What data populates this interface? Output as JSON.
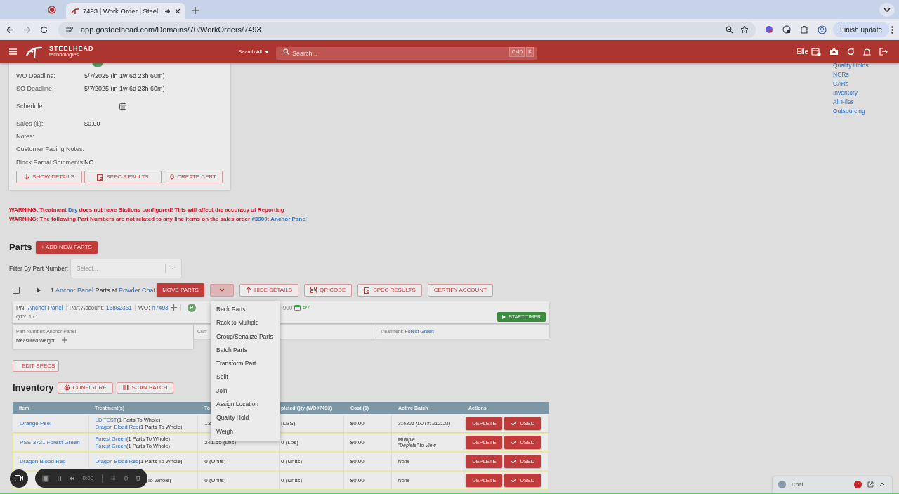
{
  "browser": {
    "tab_title": "7493 | Work Order | Steel",
    "url": "app.gosteelhead.com/Domains/70/WorkOrders/7493",
    "update_button": "Finish update"
  },
  "header": {
    "brand": "STEELHEAD",
    "brand_sub": "technologies",
    "search_scope": "Search All",
    "search_placeholder": "Search...",
    "shortcut_keys": [
      "CMD",
      "K"
    ],
    "user": "Elle"
  },
  "work_order": {
    "fields": [
      {
        "label": "WO Deadline:",
        "kind": "text",
        "value": "5/7/2025 (in 1w 6d 23h 60m)"
      },
      {
        "label": "SO Deadline:",
        "kind": "text",
        "value": "5/7/2025 (in 1w 6d 23h 60m)"
      },
      {
        "label": "Schedule:",
        "kind": "calendar"
      },
      {
        "label": "Sales ($):",
        "kind": "text",
        "value": "$0.00"
      },
      {
        "label": "Notes:",
        "kind": "text"
      },
      {
        "label": "Customer Facing Notes:",
        "kind": "text"
      },
      {
        "label": "Block Partial Shipments:",
        "kind": "text",
        "value": "NO"
      }
    ],
    "buttons": [
      "SHOW DETAILS",
      "SPEC RESULTS",
      "CREATE CERT"
    ]
  },
  "side_links": [
    "Quality Holds",
    "NCRs",
    "CARs",
    "Inventory",
    "All Files",
    "Outsourcing"
  ],
  "warnings": [
    [
      {
        "kind": "text",
        "text": "WARNING: Treatment "
      },
      {
        "kind": "link",
        "text": "Dry"
      },
      {
        "kind": "text",
        "text": " does not have Stations configured! This will affect the accuracy of Reporting"
      }
    ],
    [
      {
        "kind": "text",
        "text": "WARNING: The following Part Numbers are not related to any line items on the sales order "
      },
      {
        "kind": "link",
        "text": "#3900"
      },
      {
        "kind": "text",
        "text": ": "
      },
      {
        "kind": "link",
        "text": "Anchor Panel"
      }
    ]
  ],
  "parts": {
    "title": "Parts",
    "add_button": "+ ADD NEW PARTS",
    "filter_label": "Filter By Part Number:",
    "filter_placeholder": "Select...",
    "group": {
      "checked": false,
      "summary": [
        {
          "kind": "text",
          "text": "1 "
        },
        {
          "kind": "link",
          "text": "Anchor Panel"
        },
        {
          "kind": "text",
          "text": " Parts at "
        },
        {
          "kind": "link",
          "text": "Powder Coat"
        }
      ],
      "buttons": [
        {
          "kind": "primary",
          "label": "MOVE PARTS"
        },
        {
          "kind": "caret",
          "selected": true
        },
        {
          "kind": "outline",
          "label": "HIDE DETAILS"
        },
        {
          "kind": "outline",
          "label": "QR CODE"
        },
        {
          "kind": "outline",
          "label": "SPEC RESULTS"
        },
        {
          "kind": "outline",
          "label": "CERTIFY ACCOUNT"
        }
      ]
    },
    "part": {
      "pn_label": "PN:",
      "pn": "Anchor Panel",
      "account_label": "Part Account:",
      "account": "16862361",
      "wo_label": "WO:",
      "wo": "#7493",
      "avatar": "P",
      "order_tail": "900",
      "date": "5/7",
      "qty": "QTY: 1 / 1",
      "timer_button": "START TIMER",
      "details": [
        {
          "lines": [
            {
              "kind": "text",
              "label": "Part Number: Anchor Panel"
            },
            {
              "kind": "add",
              "label": "Measured Weight:"
            }
          ]
        },
        {
          "lines": [
            {
              "kind": "text",
              "label": "Curr"
            }
          ]
        },
        {
          "lines": [
            {
              "kind": "link",
              "label": "Treatment: ",
              "value": "Forest Green"
            }
          ]
        }
      ]
    },
    "edit_specs": "EDIT SPECS"
  },
  "menu": [
    "Rack Parts",
    "Rack to Multiple",
    "Group/Serialize Parts",
    "Batch Parts",
    "Transform Part",
    "Split",
    "Join",
    "Assign Location",
    "Quality Hold",
    "Weigh"
  ],
  "inventory": {
    "title": "Inventory",
    "buttons": [
      "CONFIGURE",
      "SCAN BATCH"
    ],
    "columns": [
      "Item",
      "Treatment(s)",
      "To",
      "pleted Qty (WO#7493)",
      "Cost ($)",
      "Active Batch",
      "Actions"
    ],
    "rows": [
      {
        "item": "Orange Peel",
        "treatments": [
          {
            "link": "LD TEST",
            "note": "(1 Parts To Whole)"
          },
          {
            "link": "Dragon Blood Red",
            "note": "(1 Parts To Whole)"
          }
        ],
        "total": "13",
        "depleted": "(LBS)",
        "cost": "$0.00",
        "batch": [
          "316321 (LOT#: 212121)"
        ],
        "highlighted": false,
        "actions": [
          "DEPLETE",
          "USED"
        ]
      },
      {
        "item": "PSS-3721 Forest Green",
        "treatments": [
          {
            "link": "Forest Green",
            "note": "(1 Parts To Whole)"
          },
          {
            "link": "Forest Green",
            "note": "(1 Parts To Whole)"
          }
        ],
        "total": "241.55 (Lbs)",
        "depleted": "0 (Lbs)",
        "cost": "$0.00",
        "batch": [
          "Multiple",
          "\"Deplete\" to View"
        ],
        "highlighted": true,
        "actions": [
          "DEPLETE",
          "USED"
        ]
      },
      {
        "item": "Dragon Blood Red",
        "treatments": [
          {
            "link": "Dragon Blood Red",
            "note": "(1 Parts To Whole)"
          }
        ],
        "total": "0 (Units)",
        "depleted": "0 (Units)",
        "cost": "$0.00",
        "batch": [
          "None"
        ],
        "highlighted": true,
        "actions": [
          "DEPLETE",
          "USED"
        ]
      },
      {
        "treatments": [
          {
            "note": "To Whole)"
          }
        ],
        "total": "0 (Units)",
        "depleted": "0 (Units)",
        "cost": "$0.00",
        "batch": [
          "None"
        ],
        "highlighted": true,
        "actions": [
          "DEPLETE",
          "USED"
        ]
      }
    ]
  },
  "recorder": {
    "time": "0:00"
  },
  "chat": {
    "label": "Chat",
    "badge": "7"
  }
}
